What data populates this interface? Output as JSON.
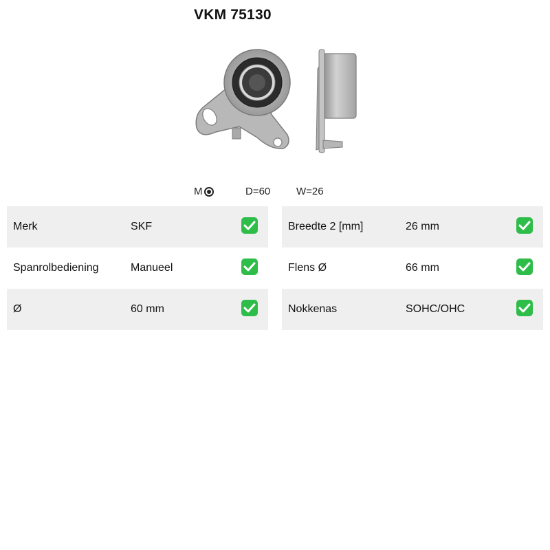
{
  "product": {
    "title": "VKM 75130"
  },
  "specs_bar": {
    "m_label": "M",
    "m_icon": "target-icon",
    "diameter": "D=60",
    "width": "W=26"
  },
  "table_left": {
    "rows": [
      {
        "label": "Merk",
        "value": "SKF",
        "icon": "check-icon"
      },
      {
        "label": "Spanrolbediening",
        "value": "Manueel",
        "icon": "check-icon"
      },
      {
        "label": "Ø",
        "value": "60 mm",
        "icon": "check-icon"
      }
    ]
  },
  "table_right": {
    "rows": [
      {
        "label": "Breedte 2 [mm]",
        "value": "26 mm",
        "icon": "check-icon"
      },
      {
        "label": "Flens Ø",
        "value": "66 mm",
        "icon": "check-icon"
      },
      {
        "label": "Nokkenas",
        "value": "SOHC/OHC",
        "icon": "check-icon"
      }
    ]
  },
  "colors": {
    "row_shade": "#efefef",
    "check_green": "#2fbd4a"
  }
}
